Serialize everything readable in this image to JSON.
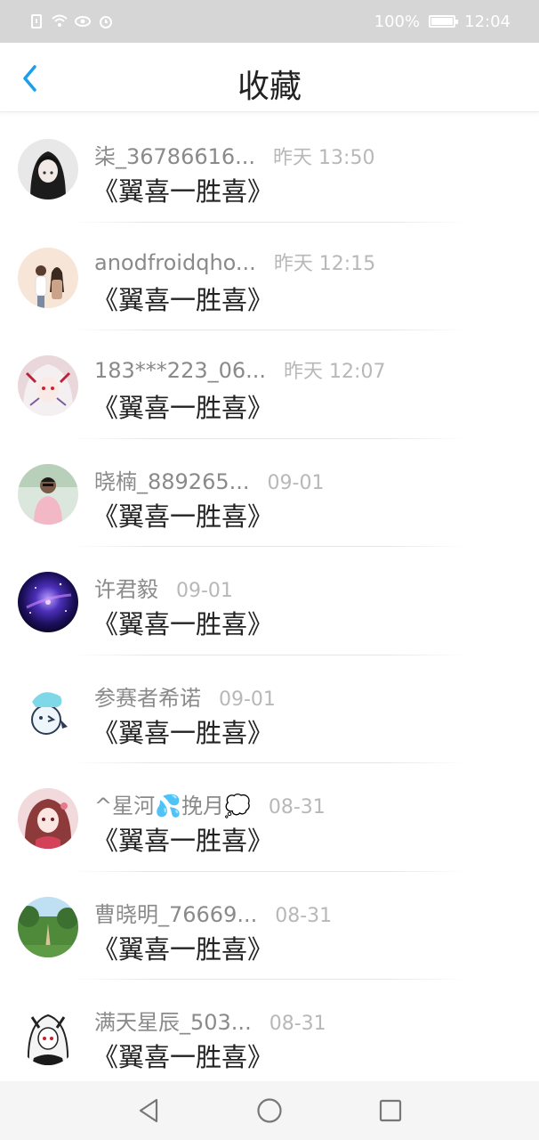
{
  "status_bar": {
    "battery": "100%",
    "time": "12:04",
    "battery_level": 1.0
  },
  "header": {
    "title": "收藏",
    "back_icon": "chevron-left-icon",
    "accent_color": "#1a9fe8"
  },
  "items": [
    {
      "name": "柒_36786616...",
      "time": "昨天 13:50",
      "title": "《翼喜一胜喜》",
      "avatar": "dark-hood"
    },
    {
      "name": "anodfroidqho...",
      "time": "昨天 12:15",
      "title": "《翼喜一胜喜》",
      "avatar": "couple"
    },
    {
      "name": "183***223_06...",
      "time": "昨天 12:07",
      "title": "《翼喜一胜喜》",
      "avatar": "anime-white-hair"
    },
    {
      "name": "晓楠_889265...",
      "time": "09-01",
      "title": "《翼喜一胜喜》",
      "avatar": "pink-shirt"
    },
    {
      "name": "许君毅",
      "time": "09-01",
      "title": "《翼喜一胜喜》",
      "avatar": "galaxy"
    },
    {
      "name": "参赛者希诺",
      "time": "09-01",
      "title": "《翼喜一胜喜》",
      "avatar": "cartoon-blue"
    },
    {
      "name": "^星河💦挽月💭",
      "time": "08-31",
      "title": "《翼喜一胜喜》",
      "avatar": "anime-red"
    },
    {
      "name": "曹晓明_76669...",
      "time": "08-31",
      "title": "《翼喜一胜喜》",
      "avatar": "path-trees"
    },
    {
      "name": "满天星辰_503...",
      "time": "08-31",
      "title": "《翼喜一胜喜》",
      "avatar": "anime-sketch"
    }
  ],
  "nav_bar": {
    "back_icon": "triangle-back-icon",
    "home_icon": "circle-home-icon",
    "recents_icon": "square-recents-icon"
  }
}
